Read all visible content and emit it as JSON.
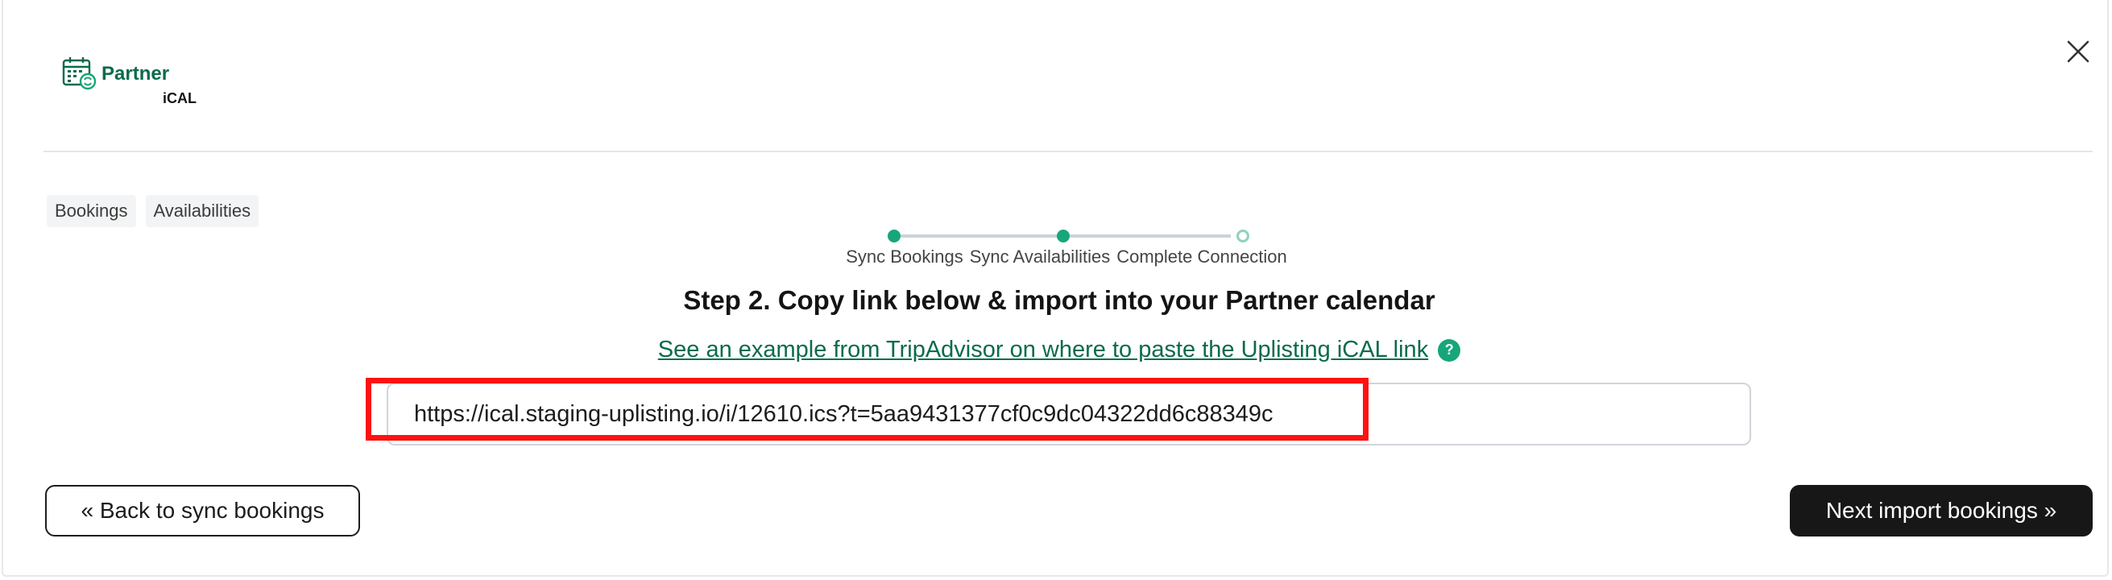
{
  "header": {
    "logo_title": "Partner",
    "logo_subtitle": "iCAL",
    "close_icon": "close-icon"
  },
  "tabs": [
    {
      "label": "Bookings"
    },
    {
      "label": "Availabilities"
    }
  ],
  "stepper": {
    "steps": [
      {
        "label": "Sync Bookings",
        "status": "completed"
      },
      {
        "label": "Sync Availabilities",
        "status": "current"
      },
      {
        "label": "Complete Connection",
        "status": "pending"
      }
    ]
  },
  "step": {
    "title": "Step 2. Copy link below & import into your Partner calendar",
    "example_link": "See an example from TripAdvisor on where to paste the Uplisting iCAL link",
    "help_glyph": "?"
  },
  "ical": {
    "url": "https://ical.staging-uplisting.io/i/12610.ics?t=5aa9431377cf0c9dc04322dd6c88349c"
  },
  "actions": {
    "back_label": "« Back to sync bookings",
    "next_label": "Next import bookings »"
  },
  "colors": {
    "brand_green": "#0b6b4b",
    "accent_green": "#17a67a",
    "highlight_red": "#ff1212",
    "primary_button": "#171717"
  }
}
